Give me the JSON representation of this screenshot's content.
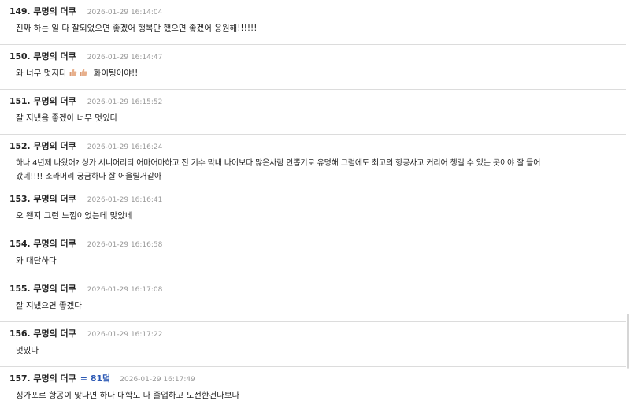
{
  "comments": [
    {
      "number": "149.",
      "author": "무명의 더쿠",
      "time": "2026-01-29 16:14:04",
      "text": "진짜 하는 일 다 잘되었으면 좋겠어 행복만 했으면 좋겠어 응원해!!!!!!"
    },
    {
      "number": "150.",
      "author": "무명의 더쿠",
      "time": "2026-01-29 16:14:47",
      "text_a": "와 너무 멋지다",
      "text_b": "화이팅이야!!",
      "emoji": "thumbs-up-icon"
    },
    {
      "number": "151.",
      "author": "무명의 더쿠",
      "time": "2026-01-29 16:15:52",
      "text": "잘 지냈음 좋겠아 너무 멋있다"
    },
    {
      "number": "152.",
      "author": "무명의 더쿠",
      "time": "2026-01-29 16:16:24",
      "line1": "하나 4년제 나왔어? 싱가 시니어리티 어마어마하고 전 기수 막내 나이보다 많은사람 안뽑기로 유명해 그럼에도 최고의 항공사고 커리어 챙길 수 있는 곳이야 잘 들어",
      "line2": "갔네!!!! 소라머리 궁금하다 잘 어울릴거같아"
    },
    {
      "number": "153.",
      "author": "무명의 더쿠",
      "time": "2026-01-29 16:16:41",
      "text": "오 왠지 그런 느낌이었는데 맞았네"
    },
    {
      "number": "154.",
      "author": "무명의 더쿠",
      "time": "2026-01-29 16:16:58",
      "text": "와 대단하다"
    },
    {
      "number": "155.",
      "author": "무명의 더쿠",
      "time": "2026-01-29 16:17:08",
      "text": "잘 지냈으면 좋겠다"
    },
    {
      "number": "156.",
      "author": "무명의 더쿠",
      "time": "2026-01-29 16:17:22",
      "text": "멋있다"
    },
    {
      "number": "157.",
      "author": "무명의 더쿠",
      "badge": "= 81덬",
      "time": "2026-01-29 16:17:49",
      "text": "싱가포르 항공이 맞다면 하나 대학도 다 졸업하고 도전한건다보다"
    }
  ],
  "colors": {
    "accent": "#2b58b4",
    "timestamp": "#999999",
    "divider": "#dcdcdc",
    "emoji": "#e8b08c"
  }
}
